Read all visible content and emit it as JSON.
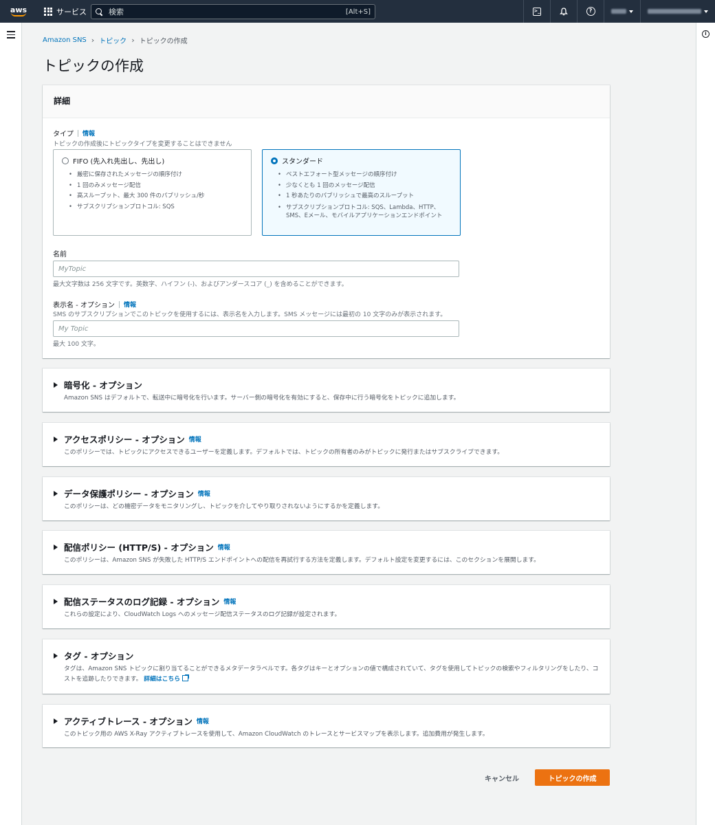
{
  "topnav": {
    "logo": "aws",
    "services_label": "サービス",
    "search_placeholder": "検索",
    "search_shortcut": "[Alt+S]",
    "icons": [
      "cloudshell-icon",
      "bell-icon",
      "help-icon"
    ]
  },
  "breadcrumb": [
    {
      "label": "Amazon SNS"
    },
    {
      "label": "トピック"
    },
    {
      "label": "トピックの作成"
    }
  ],
  "page_title": "トピックの作成",
  "details": {
    "header": "詳細",
    "type_label": "タイプ",
    "type_info": "情報",
    "type_desc": "トピックの作成後にトピックタイプを変更することはできません",
    "fifo": {
      "title": "FIFO (先入れ先出し、先出し)",
      "bullets": [
        "厳密に保存されたメッセージの順序付け",
        "1 回のみメッセージ配信",
        "高スループット、最大 300 件のパブリッシュ/秒",
        "サブスクリプションプロトコル: SQS"
      ],
      "selected": false
    },
    "standard": {
      "title": "スタンダード",
      "bullets": [
        "ベストエフォート型メッセージの順序付け",
        "少なくとも 1 回のメッセージ配信",
        "1 秒あたりのパブリッシュで最高のスループット",
        "サブスクリプションプロトコル: SQS、Lambda、HTTP、SMS、Eメール、モバイルアプリケーションエンドポイント"
      ],
      "selected": true
    },
    "name_label": "名前",
    "name_placeholder": "MyTopic",
    "name_hint": "最大文字数は 256 文字です。英数字、ハイフン (-)、およびアンダースコア (_) を含めることができます。",
    "display_label": "表示名 - オプション",
    "display_info": "情報",
    "display_desc": "SMS のサブスクリプションでこのトピックを使用するには、表示名を入力します。SMS メッセージには最初の 10 文字のみが表示されます。",
    "display_placeholder": "My Topic",
    "display_hint": "最大 100 文字。"
  },
  "sections": [
    {
      "title": "暗号化 - オプション",
      "info": "",
      "desc": "Amazon SNS はデフォルトで、転送中に暗号化を行います。サーバー側の暗号化を有効にすると、保存中に行う暗号化をトピックに追加します。"
    },
    {
      "title": "アクセスポリシー - オプション",
      "info": "情報",
      "desc": "このポリシーでは、トピックにアクセスできるユーザーを定義します。デフォルトでは、トピックの所有者のみがトピックに発行またはサブスクライブできます。"
    },
    {
      "title": "データ保護ポリシー - オプション",
      "info": "情報",
      "desc": "このポリシーは、どの機密データをモニタリングし、トピックを介してやり取りされないようにするかを定義します。"
    },
    {
      "title": "配信ポリシー (HTTP/S) - オプション",
      "info": "情報",
      "desc": "このポリシーは、Amazon SNS が失敗した HTTP/S エンドポイントへの配信を再試行する方法を定義します。デフォルト設定を変更するには、このセクションを展開します。"
    },
    {
      "title": "配信ステータスのログ記録 - オプション",
      "info": "情報",
      "desc": "これらの設定により、CloudWatch Logs へのメッセージ配信ステータスのログ記録が設定されます。"
    },
    {
      "title": "タグ - オプション",
      "info": "",
      "desc": "タグは、Amazon SNS トピックに割り当てることができるメタデータラベルです。各タグはキーとオプションの値で構成されていて、タグを使用してトピックの検索やフィルタリングをしたり、コストを追跡したりできます。",
      "link": "詳細はこちら"
    },
    {
      "title": "アクティブトレース - オプション",
      "info": "情報",
      "desc": "このトピック用の AWS X-Ray アクティブトレースを使用して、Amazon CloudWatch のトレースとサービスマップを表示します。追加費用が発生します。"
    }
  ],
  "footer": {
    "cancel_label": "キャンセル",
    "create_label": "トピックの作成"
  },
  "colors": {
    "nav_bg": "#232f3e",
    "link": "#0073bb",
    "primary_button": "#ec7211"
  }
}
